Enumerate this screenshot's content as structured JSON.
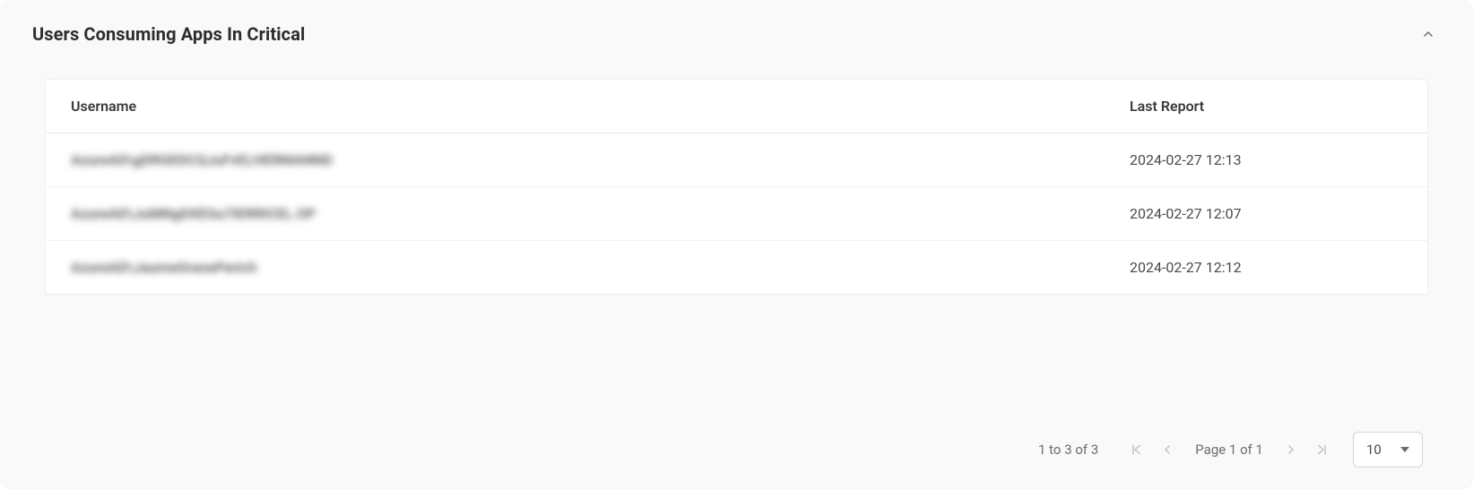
{
  "panel": {
    "title": "Users Consuming Apps In Critical"
  },
  "table": {
    "columns": {
      "username": "Username",
      "last_report": "Last Report"
    },
    "rows": [
      {
        "username": "AzureAD\\gDRGEDCQJuFvELHERMANND",
        "last_report": "2024-02-27 12:13"
      },
      {
        "username": "AzureAD\\JuMNgDXEGu7IERRICEL.OP",
        "last_report": "2024-02-27 12:07"
      },
      {
        "username": "AzureAD\\JaumeGranePerich",
        "last_report": "2024-02-27 12:12"
      }
    ]
  },
  "pager": {
    "range_text": "1 to 3 of 3",
    "page_text": "Page 1 of 1",
    "page_size": "10"
  }
}
